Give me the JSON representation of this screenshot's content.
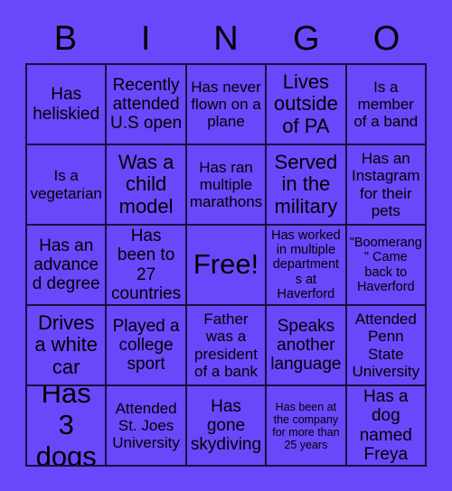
{
  "card": {
    "title": "BINGO",
    "background_color": "#6b47fb",
    "grid_line_color": "#16103a",
    "text_color": "#000000",
    "header_letters": [
      "B",
      "I",
      "N",
      "G",
      "O"
    ],
    "rows": [
      [
        {
          "text": "Has heliskied",
          "size": "lg"
        },
        {
          "text": "Recently attended U.S open",
          "size": "lg"
        },
        {
          "text": "Has never flown on a plane",
          "size": "md"
        },
        {
          "text": "Lives outside of PA",
          "size": "xl"
        },
        {
          "text": "Is a member of a band",
          "size": "md"
        }
      ],
      [
        {
          "text": "Is a vegetarian",
          "size": "md"
        },
        {
          "text": "Was a child model",
          "size": "xl"
        },
        {
          "text": "Has ran multiple marathons",
          "size": "md"
        },
        {
          "text": "Served in the military",
          "size": "xl"
        },
        {
          "text": "Has an Instagram for their pets",
          "size": "md"
        }
      ],
      [
        {
          "text": "Has an advanced degree",
          "size": "lg"
        },
        {
          "text": "Has been to 27 countries",
          "size": "lg"
        },
        {
          "text": "Free!",
          "size": "xxl"
        },
        {
          "text": "Has worked in multiple departments at Haverford",
          "size": "sm"
        },
        {
          "text": "\"Boomerang\" Came back to Haverford",
          "size": "sm"
        }
      ],
      [
        {
          "text": "Drives a white car",
          "size": "xl"
        },
        {
          "text": "Played a college sport",
          "size": "lg"
        },
        {
          "text": "Father was a president of a bank",
          "size": "md"
        },
        {
          "text": "Speaks another language",
          "size": "lg"
        },
        {
          "text": "Attended Penn State University",
          "size": "md"
        }
      ],
      [
        {
          "text": "Has 3 dogs",
          "size": "xxl"
        },
        {
          "text": "Attended St. Joes University",
          "size": "md"
        },
        {
          "text": "Has gone skydiving",
          "size": "lg"
        },
        {
          "text": "Has been at the company for more than 25 years",
          "size": "xs"
        },
        {
          "text": "Has a dog named Freya",
          "size": "lg"
        }
      ]
    ]
  }
}
